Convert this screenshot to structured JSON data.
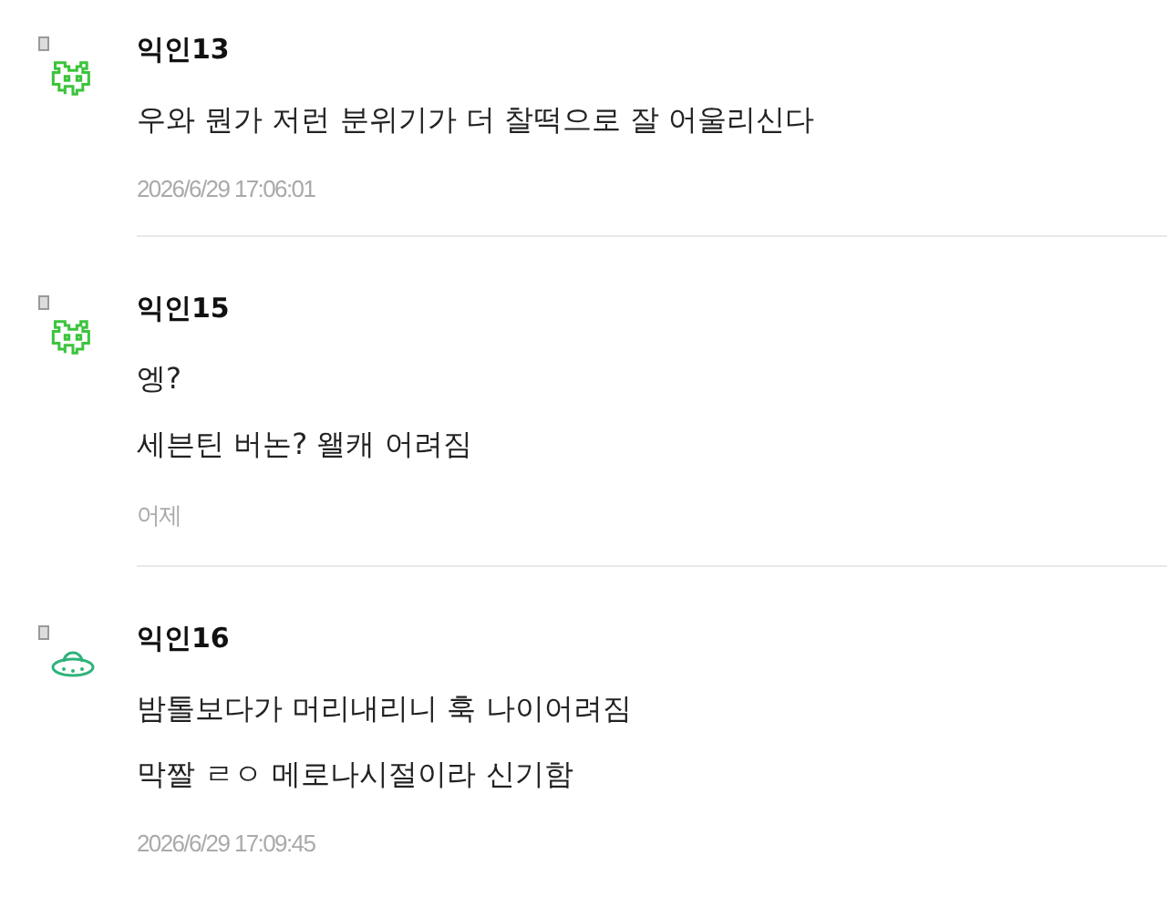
{
  "comments": [
    {
      "kind": "invader",
      "author": "익인13",
      "lines": [
        "우와 뭔가 저런 분위기가 더 찰떡으로 잘 어울리신다"
      ],
      "time": "2026/6/29 17:06:01"
    },
    {
      "kind": "invader",
      "author": "익인15",
      "lines": [
        "엥?",
        "세븐틴 버논? 왤캐 어려짐"
      ],
      "time": "어제"
    },
    {
      "kind": "ufo",
      "author": "익인16",
      "lines": [
        "밤톨보다가 머리내리니 훅 나이어려짐",
        "막짤 ㄹㅇ 메로나시절이라 신기함"
      ],
      "time": "2026/6/29 17:09:45"
    }
  ]
}
